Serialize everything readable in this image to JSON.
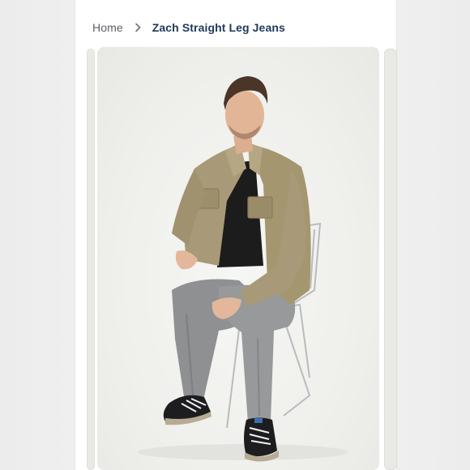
{
  "breadcrumb": {
    "home_label": "Home",
    "separator_icon": "chevron-right-icon",
    "current_label": "Zach Straight Leg Jeans"
  },
  "gallery": {
    "main_image_icon": "product-photo-model-seated",
    "colors": {
      "jacket": "#a89a78",
      "shirt": "#1c1c1c",
      "jeans": "#8e8f91",
      "shoes": "#1d1d1f",
      "background": "#f1f1ef"
    }
  }
}
